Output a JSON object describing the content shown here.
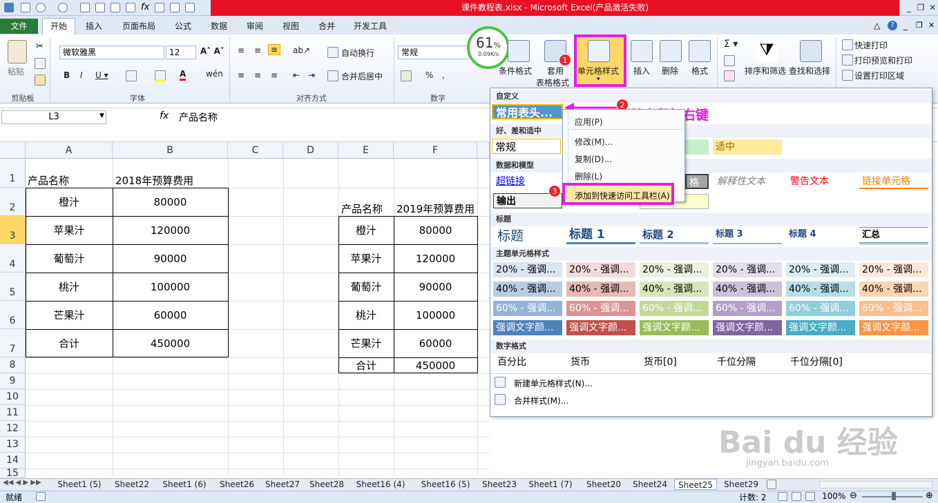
{
  "title": "课件教程表.xlsx - Microsoft Excel(产品激活失败)",
  "tabs": [
    "文件",
    "开始",
    "插入",
    "页面布局",
    "公式",
    "数据",
    "审阅",
    "视图",
    "合并",
    "开发工具"
  ],
  "ribbon": {
    "clipboard": {
      "paste": "粘贴",
      "label": "剪贴板"
    },
    "font": {
      "name": "微软雅黑",
      "size": "12",
      "label": "字体"
    },
    "align": {
      "wrap": "自动换行",
      "merge": "合并后居中",
      "label": "对齐方式"
    },
    "number": {
      "format": "常规",
      "label": "数字"
    },
    "speed": {
      "percent": "61",
      "unit": "%",
      "rate": "0.09K/s"
    },
    "styles": {
      "cond": "条件格式",
      "table1": "套用",
      "table2": "表格格式",
      "cell": "单元格样式"
    },
    "cells": {
      "insert": "插入",
      "delete": "删除",
      "format": "格式"
    },
    "editing": {
      "sort": "排序和筛选",
      "find": "查找和选择"
    },
    "print": {
      "quick": "快速打印",
      "preview": "打印预览和打印",
      "area": "设置打印区域"
    }
  },
  "formula": {
    "namebox": "L3",
    "fx": "fx",
    "value": "产品名称"
  },
  "columns": [
    "A",
    "B",
    "C",
    "D",
    "E",
    "F"
  ],
  "rows": [
    "1",
    "2",
    "3",
    "4",
    "5",
    "6",
    "7",
    "8",
    "9",
    "10",
    "11",
    "12",
    "13",
    "14",
    "15"
  ],
  "table1": {
    "h1": "产品名称",
    "h2": "2018年预算费用",
    "items": [
      [
        "橙汁",
        "80000"
      ],
      [
        "苹果汁",
        "120000"
      ],
      [
        "葡萄汁",
        "90000"
      ],
      [
        "桃汁",
        "100000"
      ],
      [
        "芒果汁",
        "60000"
      ],
      [
        "合计",
        "450000"
      ]
    ]
  },
  "table2": {
    "h1": "产品名称",
    "h2": "2019年预算费用",
    "items": [
      [
        "橙汁",
        "80000"
      ],
      [
        "苹果汁",
        "120000"
      ],
      [
        "葡萄汁",
        "90000"
      ],
      [
        "桃汁",
        "100000"
      ],
      [
        "芒果汁",
        "60000"
      ],
      [
        "合计",
        "450000"
      ]
    ]
  },
  "gallery": {
    "custom": "自定义",
    "custom_style": "常用表头...",
    "good_bad": "好、差和适中",
    "normal": "常规",
    "neutral": "适中",
    "data_model": "数据和模型",
    "hyperlink": "超链接",
    "output": "输出",
    "check_partial": "格",
    "explanatory": "解释性文本",
    "warning": "警告文本",
    "linked": "链接单元格",
    "titles": "标题",
    "title": "标题",
    "h1": "标题 1",
    "h2": "标题 2",
    "h3": "标题 3",
    "h4": "标题 4",
    "total": "汇总",
    "theme": "主题单元格样式",
    "t20": "20% - 强调...",
    "t40": "40% - 强调...",
    "t60": "60% - 强调...",
    "tacc": "强调文字颜...",
    "numfmt": "数字格式",
    "percent": "百分比",
    "currency": "货币",
    "currency0": "货币[0]",
    "comma": "千位分隔",
    "comma0": "千位分隔[0]",
    "new_style": "新建单元格样式(N)...",
    "merge_styles": "合并样式(M)..."
  },
  "context": {
    "apply": "应用(P)",
    "modify": "修改(M)...",
    "copy": "复制(D)...",
    "delete": "删除(L)",
    "add_qat": "添加到快速访问工具栏(A)"
  },
  "annotation": {
    "text": "单击鼠标右键",
    "b1": "1",
    "b2": "2",
    "b3": "3"
  },
  "sheets": [
    "Sheet1 (5)",
    "Sheet22",
    "Sheet1 (6)",
    "Sheet26",
    "Sheet27",
    "Sheet28",
    "Sheet16 (4)",
    "Sheet16 (5)",
    "Sheet23",
    "Sheet1 (7)",
    "Sheet20",
    "Sheet24",
    "Sheet25",
    "Sheet29"
  ],
  "status": {
    "ready": "就绪",
    "count": "计数: 2",
    "zoom": "100%"
  },
  "watermark": {
    "brand": "Bai du 经验",
    "url": "jingyan.baidu.com"
  },
  "colors": {
    "accent": "#e020e0",
    "file_tab": "#2a7b3a",
    "title_red": "#e81123"
  }
}
